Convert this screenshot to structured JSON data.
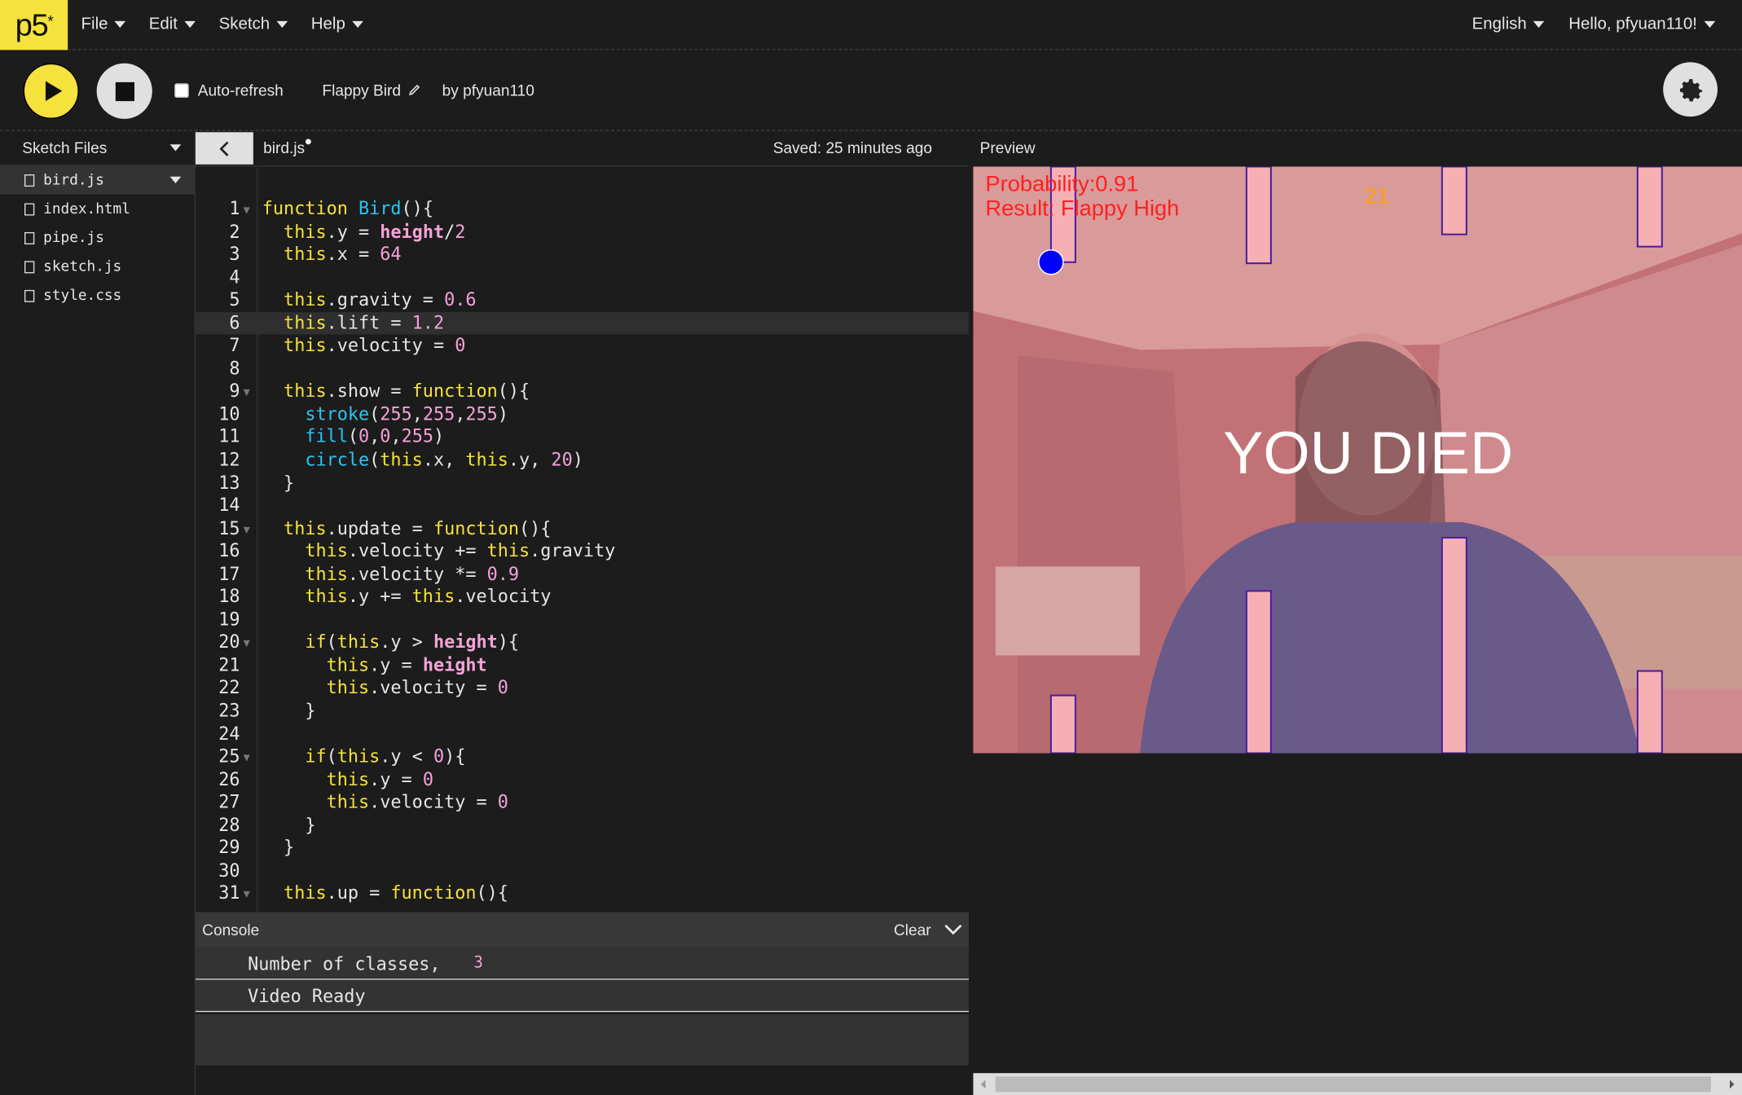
{
  "menubar": {
    "logo": "p5",
    "logo_sup": "*",
    "items": [
      "File",
      "Edit",
      "Sketch",
      "Help"
    ],
    "language": "English",
    "user": "Hello, pfyuan110!"
  },
  "toolbar": {
    "auto_refresh": "Auto-refresh",
    "sketch_name": "Flappy Bird",
    "author": "by pfyuan110"
  },
  "files": {
    "header": "Sketch Files",
    "items": [
      "bird.js",
      "index.html",
      "pipe.js",
      "sketch.js",
      "style.css"
    ]
  },
  "editor": {
    "tab": "bird.js",
    "saved": "Saved: 25 minutes ago"
  },
  "code": [
    "function Bird(){",
    "  this.y = height/2",
    "  this.x = 64",
    "",
    "  this.gravity = 0.6",
    "  this.lift = 1.2",
    "  this.velocity = 0",
    "",
    "  this.show = function(){",
    "    stroke(255,255,255)",
    "    fill(0,0,255)",
    "    circle(this.x, this.y, 20)",
    "  }",
    "",
    "  this.update = function(){",
    "    this.velocity += this.gravity",
    "    this.velocity *= 0.9",
    "    this.y += this.velocity",
    "",
    "    if(this.y > height){",
    "      this.y = height",
    "      this.velocity = 0",
    "    }",
    "",
    "    if(this.y < 0){",
    "      this.y = 0",
    "      this.velocity = 0",
    "    }",
    "  }",
    "",
    "  this.up = function(){"
  ],
  "console": {
    "title": "Console",
    "clear": "Clear",
    "lines": [
      {
        "text": "Number of classes,",
        "value": "3"
      },
      {
        "text": "Video Ready",
        "value": ""
      }
    ]
  },
  "preview": {
    "label": "Preview",
    "probability": "Probability:0.91",
    "result": "Result: Flappy High",
    "score": "21",
    "died": "YOU DIED"
  }
}
